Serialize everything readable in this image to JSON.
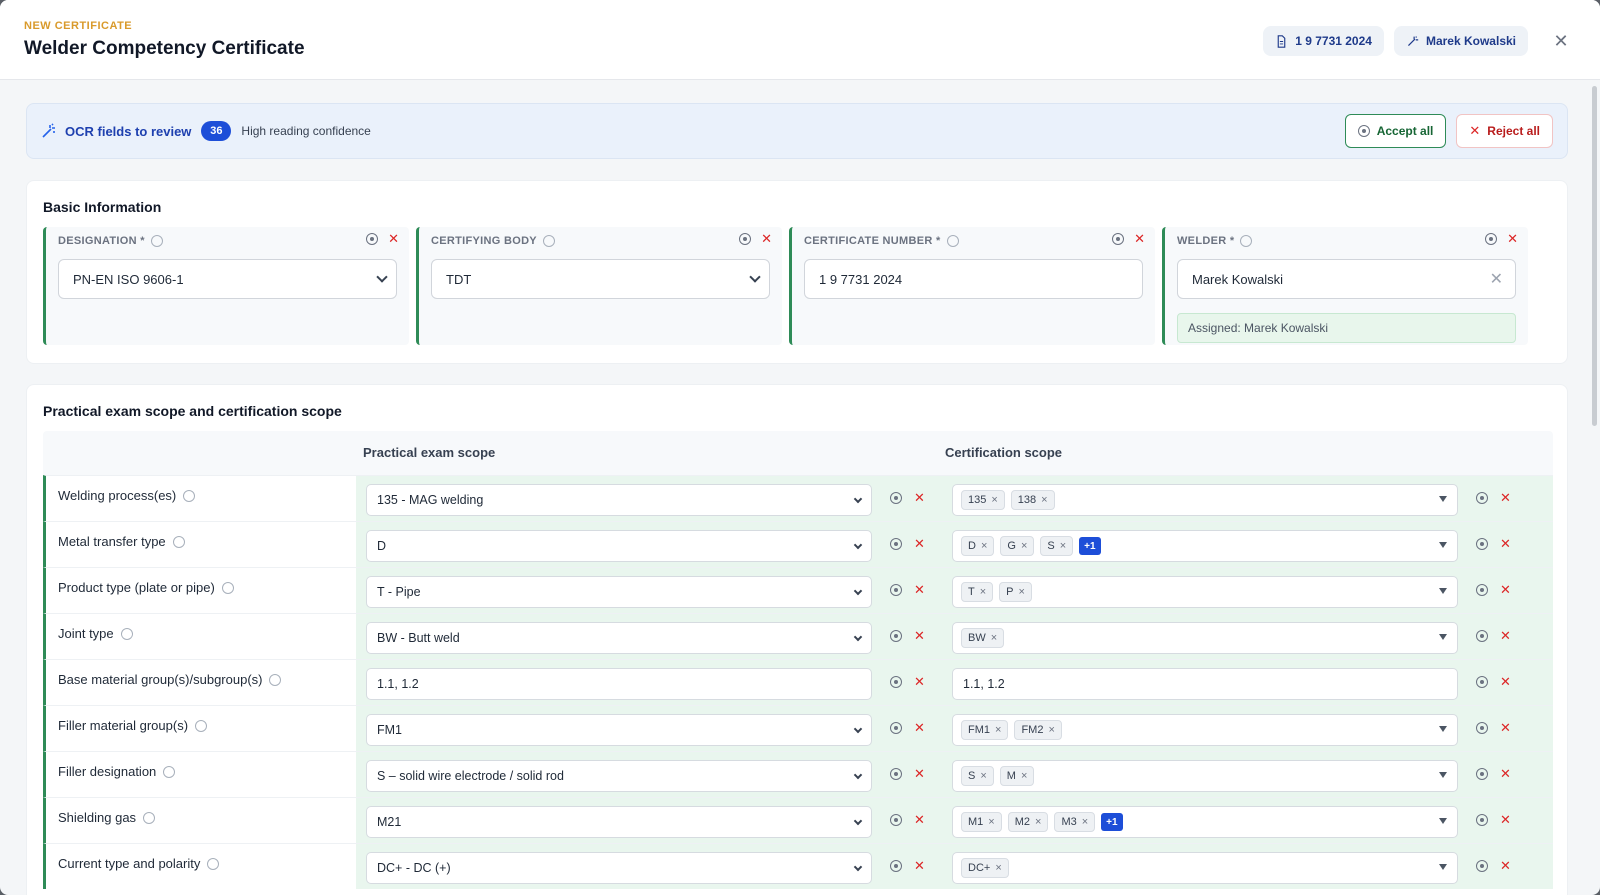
{
  "header": {
    "eyebrow": "NEW CERTIFICATE",
    "title": "Welder Competency Certificate",
    "cert_chip": "1 9 7731 2024",
    "welder_chip": "Marek Kowalski"
  },
  "ocr": {
    "title": "OCR fields to review",
    "count": "36",
    "confidence": "High reading confidence",
    "accept_label": "Accept all",
    "reject_label": "Reject all"
  },
  "basic": {
    "title": "Basic Information",
    "fields": [
      {
        "label": "DESIGNATION *",
        "value": "PN-EN ISO 9606-1"
      },
      {
        "label": "CERTIFYING BODY",
        "value": "TDT"
      },
      {
        "label": "CERTIFICATE NUMBER *",
        "value": "1 9 7731 2024"
      },
      {
        "label": "WELDER *",
        "value": "Marek Kowalski",
        "assigned": "Assigned: Marek Kowalski"
      }
    ]
  },
  "scope": {
    "title": "Practical exam scope and certification scope",
    "col_exam": "Practical exam scope",
    "col_cert": "Certification scope",
    "rows": [
      {
        "label": "Welding process(es)",
        "exam": "135 - MAG welding",
        "tags": [
          "135",
          "138"
        ],
        "more": ""
      },
      {
        "label": "Metal transfer type",
        "exam": "D",
        "tags": [
          "D",
          "G",
          "S"
        ],
        "more": "+1"
      },
      {
        "label": "Product type (plate or pipe)",
        "exam": "T - Pipe",
        "tags": [
          "T",
          "P"
        ],
        "more": ""
      },
      {
        "label": "Joint type",
        "exam": "BW - Butt weld",
        "tags": [
          "BW"
        ],
        "more": ""
      },
      {
        "label": "Base material group(s)/subgroup(s)",
        "exam": "1.1, 1.2",
        "cert_text": "1.1, 1.2"
      },
      {
        "label": "Filler material group(s)",
        "exam": "FM1",
        "tags": [
          "FM1",
          "FM2"
        ],
        "more": ""
      },
      {
        "label": "Filler designation",
        "exam": "S – solid wire electrode / solid rod",
        "tags": [
          "S",
          "M"
        ],
        "more": ""
      },
      {
        "label": "Shielding gas",
        "exam": "M21",
        "tags": [
          "M1",
          "M2",
          "M3"
        ],
        "more": "+1"
      },
      {
        "label": "Current type and polarity",
        "exam": "DC+ - DC (+)",
        "tags": [
          "DC+"
        ],
        "more": ""
      }
    ]
  }
}
